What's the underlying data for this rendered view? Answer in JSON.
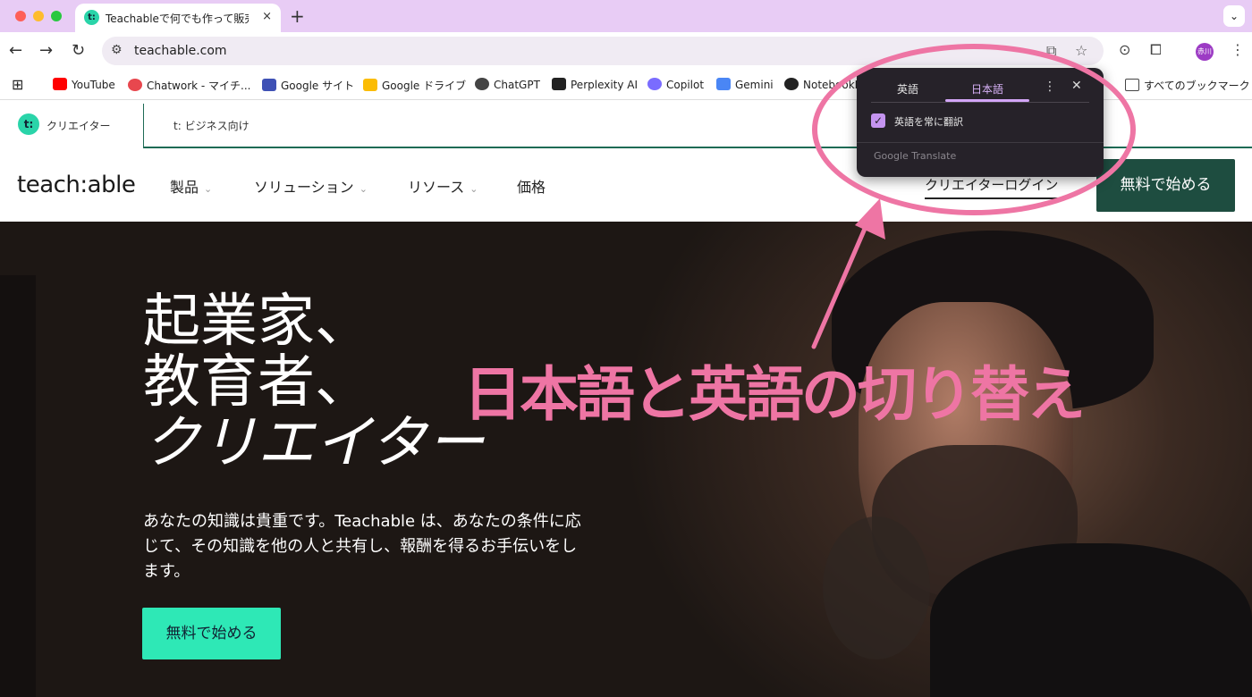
{
  "browser": {
    "tab": {
      "title": "Teachableで何でも作って販売し",
      "favicon": "t:",
      "close": "×"
    },
    "new_tab": "+",
    "tab_menu": "⌄",
    "nav": {
      "back": "←",
      "forward": "→",
      "reload": "↻"
    },
    "omnibox": {
      "url": "teachable.com",
      "tune": "⚙"
    },
    "icons": {
      "translate": "⧉",
      "star": "☆",
      "camera": "⊙",
      "extensions": "⧠",
      "menu": "⋮"
    },
    "profile": "赤川"
  },
  "bookmarks": {
    "apps": "⊞",
    "items": [
      {
        "label": "YouTube",
        "color": "#ff0000"
      },
      {
        "label": "Chatwork - マイチ...",
        "color": "#e8474e"
      },
      {
        "label": "Google サイト",
        "color": "#3f51b5"
      },
      {
        "label": "Google ドライブ",
        "color": "#fbbc04"
      },
      {
        "label": "ChatGPT",
        "color": "#444444"
      },
      {
        "label": "Perplexity AI",
        "color": "#222222"
      },
      {
        "label": "Copilot",
        "color": "#7a6cff"
      },
      {
        "label": "Gemini",
        "color": "#4a86f5"
      },
      {
        "label": "NotebookLM",
        "color": "#222222"
      }
    ],
    "all_bookmarks": "すべてのブックマーク"
  },
  "site": {
    "creator_label": "クリエイター",
    "creator_logo": "t:",
    "business_label": "t: ビジネス向け",
    "brand": "teach:able",
    "nav": [
      {
        "label": "製品",
        "chevron": "⌄"
      },
      {
        "label": "ソリューション",
        "chevron": "⌄"
      },
      {
        "label": "リソース",
        "chevron": "⌄"
      },
      {
        "label": "価格"
      }
    ],
    "login": "クリエイターログイン",
    "cta": "無料で始める"
  },
  "hero": {
    "headline": [
      "起業家、",
      "教育者、",
      "クリエイター"
    ],
    "paragraph": "あなたの知識は貴重です。Teachable は、あなたの条件に応じて、その知識を他の人と共有し、報酬を得るお手伝いをします。",
    "cta": "無料で始める"
  },
  "translate_popup": {
    "tabs": [
      "英語",
      "日本語"
    ],
    "active_tab": "日本語",
    "menu": "⋮",
    "close": "✕",
    "checkbox_label": "英語を常に翻訳",
    "checked": true,
    "check_mark": "✓",
    "brand": "Google Translate"
  },
  "annotation": {
    "text": "日本語と英語の切り替え",
    "color": "#ee75a4"
  }
}
